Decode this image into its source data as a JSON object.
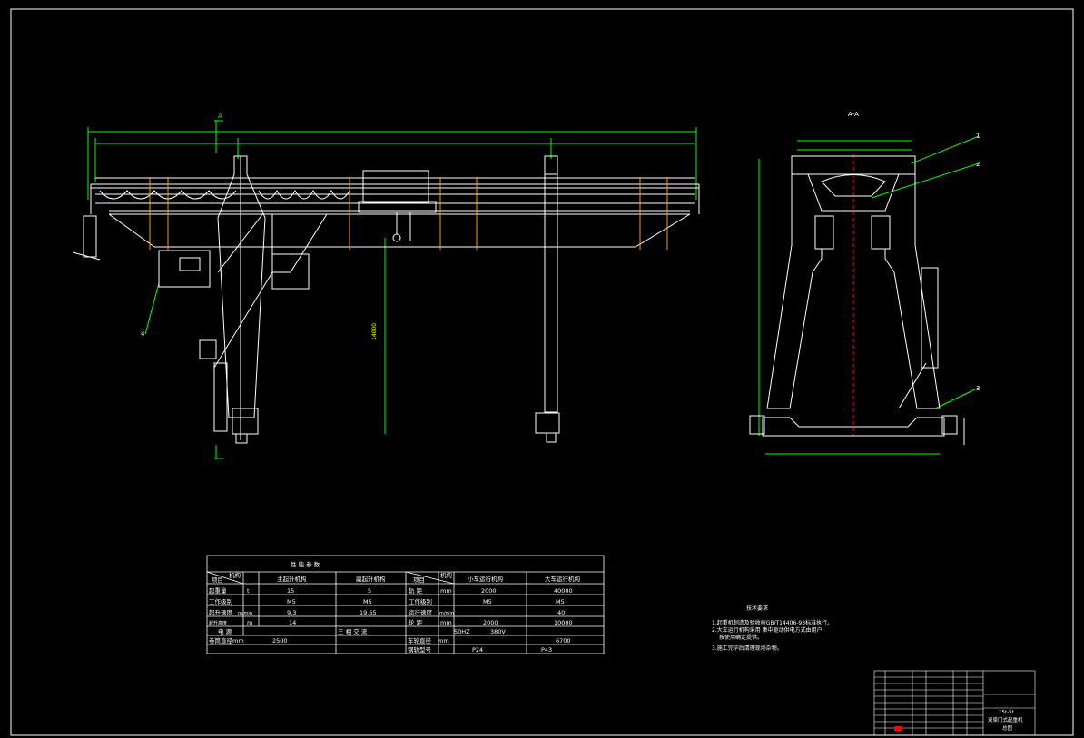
{
  "drawing": {
    "section_marker_left": "A",
    "section_marker_right": "A-A",
    "height_dim": "14000",
    "callouts": [
      "1",
      "2",
      "3",
      "4"
    ]
  },
  "param_table": {
    "title": "性 能 参 数",
    "hdr_item": "项目",
    "hdr_mech": "机构",
    "hdr_main_hoist": "主起升机构",
    "hdr_aux_hoist": "副起升机构",
    "hdr_item2": "项目",
    "hdr_mech2": "机构",
    "hdr_trolley": "小车运行机构",
    "hdr_crane": "大车运行机构",
    "rows": [
      {
        "label": "起重量",
        "unit": "t",
        "main": "15",
        "aux": "5",
        "label2": "轨 距",
        "unit2": "mm",
        "trolley": "2000",
        "crane": "40000"
      },
      {
        "label": "工作级别",
        "unit": "",
        "main": "M5",
        "aux": "M5",
        "label2": "工作级别",
        "unit2": "",
        "trolley": "M5",
        "crane": "M5"
      },
      {
        "label": "起升速度",
        "unit": "m/min",
        "main": "9.3",
        "aux": "19.65",
        "label2": "运行速度",
        "unit2": "m/min",
        "trolley": "",
        "crane": "40"
      },
      {
        "label": "起升高度",
        "unit": "m",
        "main": "14",
        "aux": "",
        "label2": "轮 距",
        "unit2": "mm",
        "trolley": "2000",
        "crane": "10000"
      }
    ],
    "power_label": "电 源",
    "power_value": "三 相 交 流",
    "power_v": "50HZ",
    "power_v2": "380V",
    "wheel_dia_label": "卷筒直径",
    "wheel_dia_unit": "mm",
    "wheel_dia_value": "2500",
    "axle_label": "车轮直径",
    "axle_unit": "mm",
    "axle_value": "6700",
    "rail_label": "钢轨型号",
    "rail_trolley": "P24",
    "rail_crane": "P43"
  },
  "notes": {
    "title": "技术要求",
    "items": [
      "1.起重机制造及验收按GB/T14406-93标准执行。",
      "2.大车运行机构采用 集中驱动供电方式由用户",
      "按使用确定提供。",
      "3.施工完毕后清理现场杂物。"
    ]
  },
  "title_block": {
    "spec_line": "15t-5t",
    "name_line": "双梁门式起重机",
    "drawing_type": "总图"
  }
}
